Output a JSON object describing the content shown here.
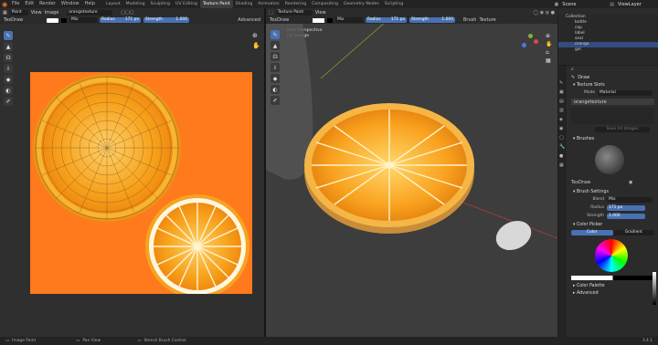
{
  "topbar": {
    "menus": [
      "File",
      "Edit",
      "Render",
      "Window",
      "Help"
    ],
    "workspaces": [
      "Layout",
      "Modeling",
      "Sculpting",
      "UV Editing",
      "Texture Paint",
      "Shading",
      "Animation",
      "Rendering",
      "Compositing",
      "Geometry Nodes",
      "Scripting"
    ],
    "active_workspace": "Texture Paint",
    "scene": "Scene",
    "view_layer": "ViewLayer"
  },
  "image_editor": {
    "mode": "Paint",
    "menus": [
      "View",
      "Image"
    ],
    "image_name": "orangetexture",
    "brush": "TexDraw",
    "blend": "Mix",
    "radius_label": "Radius",
    "radius": "171 px",
    "strength_label": "Strength",
    "strength": "1.000",
    "advanced": "Advanced"
  },
  "viewport": {
    "mode": "Texture Paint",
    "menus": [
      "View"
    ],
    "brush": "TexDraw",
    "blend": "Mix",
    "radius_label": "Radius",
    "radius": "171 px",
    "strength_label": "Strength",
    "strength": "1.000",
    "brush_menu": "Brush",
    "texture_menu": "Texture",
    "view_name": "User Perspective",
    "object_name": "(1) orange"
  },
  "outliner": {
    "items": [
      "Collection",
      "bottle",
      "cap",
      "label",
      "seal",
      "orange",
      "gel"
    ]
  },
  "properties": {
    "tool_label": "Draw",
    "texture_slots": "Texture Slots",
    "mode_label": "Mode",
    "mode_value": "Material",
    "slot_name": "orangetexture",
    "save_images": "Save All Images",
    "brushes": "Brushes",
    "brush_name": "TexDraw",
    "brush_settings": "Brush Settings",
    "blend_label": "Blend",
    "blend_value": "Mix",
    "radius_label": "Radius",
    "radius_value": "171 px",
    "strength_label": "Strength",
    "strength_value": "1.000",
    "color_picker": "Color Picker",
    "color_tab": "Color",
    "gradient_tab": "Gradient",
    "color_palette": "Color Palette",
    "advanced": "Advanced"
  },
  "statusbar": {
    "left": "Image Paint",
    "mid": "Pan View",
    "right": "Stencil Brush Control",
    "version": "3.4.1"
  },
  "colors": {
    "accent": "#4772b3",
    "orange_bg": "#ff7a1c"
  }
}
